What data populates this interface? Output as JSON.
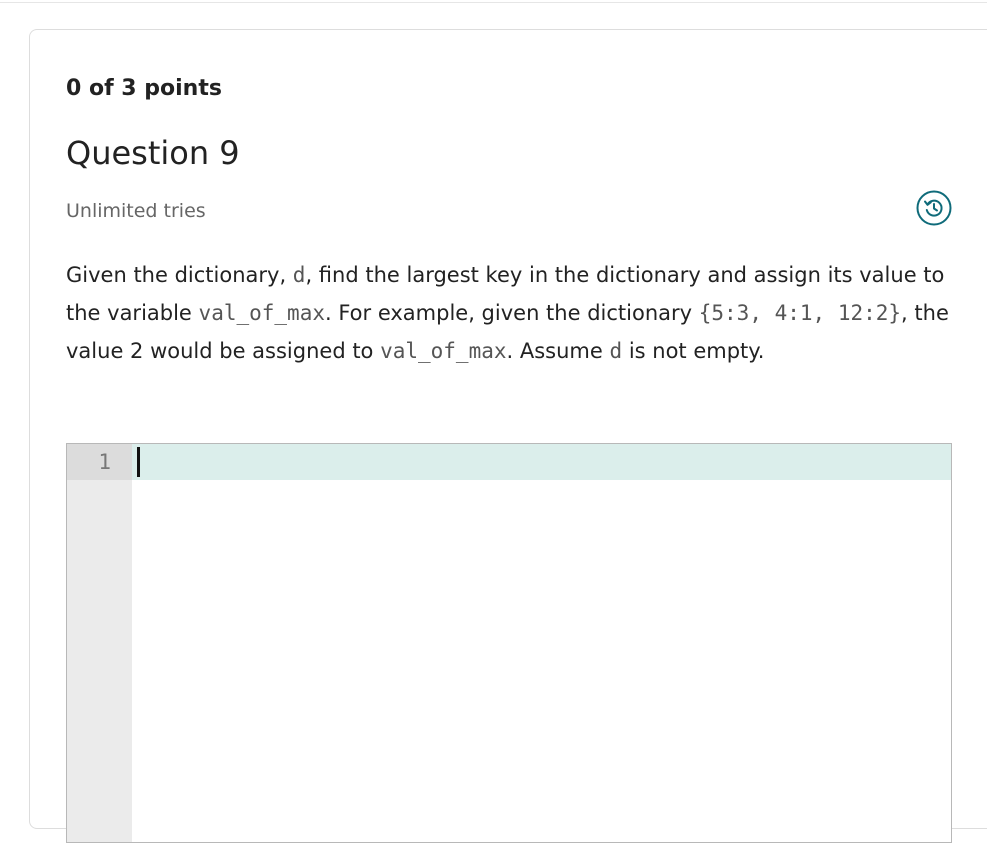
{
  "question": {
    "points_text": "0 of 3 points",
    "title": "Question 9",
    "tries_text": "Unlimited tries",
    "prompt_segments": [
      {
        "text": "Given the dictionary, ",
        "code": false
      },
      {
        "text": "d",
        "code": true
      },
      {
        "text": ", find the largest key in the dictionary and assign its value to the variable ",
        "code": false
      },
      {
        "text": "val_of_max",
        "code": true
      },
      {
        "text": ". For example, given the dictionary ",
        "code": false
      },
      {
        "text": "{5:3, 4:1, 12:2}",
        "code": true
      },
      {
        "text": ", the value 2 would be assigned to ",
        "code": false
      },
      {
        "text": "val_of_max",
        "code": true
      },
      {
        "text": ". Assume ",
        "code": false
      },
      {
        "text": "d",
        "code": true
      },
      {
        "text": " is not empty.",
        "code": false
      }
    ]
  },
  "history_icon": {
    "name": "history-icon",
    "color": "#0f6b7a"
  },
  "editor": {
    "line_numbers": [
      "1"
    ],
    "value": "",
    "active_line_color": "#dbeeeb"
  }
}
